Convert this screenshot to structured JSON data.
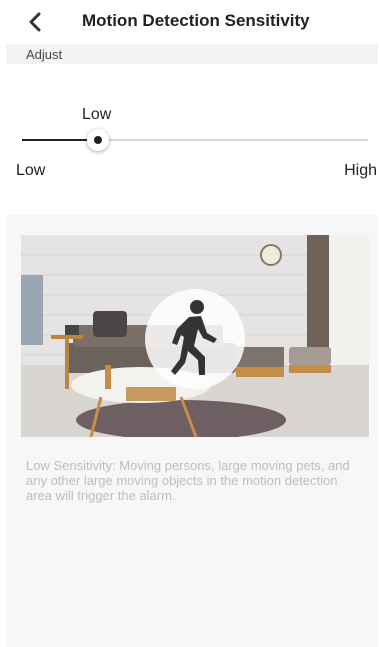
{
  "header": {
    "title": "Motion Detection Sensitivity",
    "back_icon": "chevron-left-icon"
  },
  "section": {
    "label": "Adjust"
  },
  "slider": {
    "current_label": "Low",
    "min_label": "Low",
    "max_label": "High",
    "value_fraction": 0.22
  },
  "preview": {
    "icon": "walking-person-icon",
    "description": "Low Sensitivity: Moving persons, large moving pets, and any other large moving objects in the motion detection area will trigger the alarm."
  },
  "colors": {
    "accent": "#222222",
    "track": "#d9d9d9",
    "panel": "#f7f7f7",
    "description_text": "#bdbdbd"
  }
}
